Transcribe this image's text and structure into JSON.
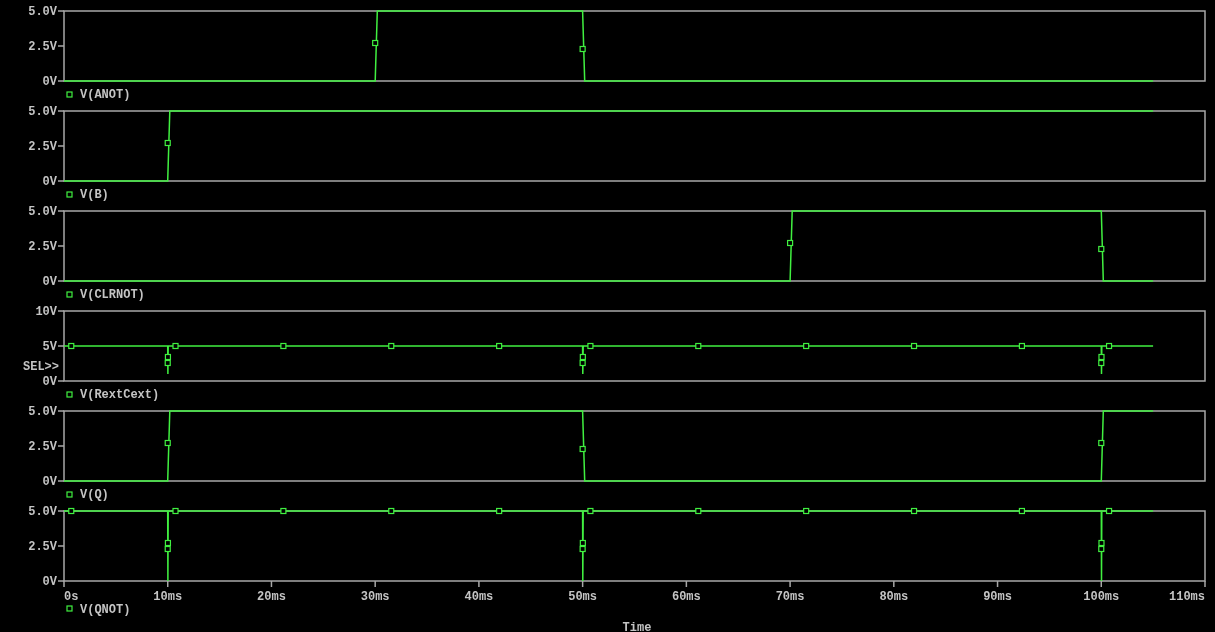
{
  "plots": [
    {
      "chart_data": {
        "type": "line",
        "xlim": [
          0,
          110
        ],
        "ylim": [
          0,
          5
        ],
        "yticks": [
          {
            "value": 0,
            "label": "0V"
          },
          {
            "value": 2.5,
            "label": "2.5V"
          },
          {
            "value": 5,
            "label": "5.0V"
          }
        ],
        "series": [
          {
            "name": "V(ANOT)",
            "color": "#40f040",
            "x": [
              0,
              30,
              30.2,
              50,
              50.2,
              105
            ],
            "values": [
              0,
              0,
              5,
              5,
              0,
              0
            ]
          }
        ]
      }
    },
    {
      "chart_data": {
        "type": "line",
        "xlim": [
          0,
          110
        ],
        "ylim": [
          0,
          5
        ],
        "yticks": [
          {
            "value": 0,
            "label": "0V"
          },
          {
            "value": 2.5,
            "label": "2.5V"
          },
          {
            "value": 5,
            "label": "5.0V"
          }
        ],
        "series": [
          {
            "name": "V(B)",
            "color": "#40f040",
            "x": [
              0,
              10,
              10.2,
              105
            ],
            "values": [
              0,
              0,
              5,
              5
            ]
          }
        ]
      }
    },
    {
      "chart_data": {
        "type": "line",
        "xlim": [
          0,
          110
        ],
        "ylim": [
          0,
          5
        ],
        "yticks": [
          {
            "value": 0,
            "label": "0V"
          },
          {
            "value": 2.5,
            "label": "2.5V"
          },
          {
            "value": 5,
            "label": "5.0V"
          }
        ],
        "series": [
          {
            "name": "V(CLRNOT)",
            "color": "#40f040",
            "x": [
              0,
              70,
              70.2,
              100,
              100.2,
              105
            ],
            "values": [
              0,
              0,
              5,
              5,
              0,
              0
            ]
          }
        ]
      }
    },
    {
      "selector_label": "SEL>>",
      "chart_data": {
        "type": "line",
        "xlim": [
          0,
          110
        ],
        "ylim": [
          0,
          10
        ],
        "yticks": [
          {
            "value": 0,
            "label": "0V"
          },
          {
            "value": 5,
            "label": "5V"
          },
          {
            "value": 10,
            "label": "10V"
          }
        ],
        "series": [
          {
            "name": "V(RextCext)",
            "color": "#40f040",
            "x": [
              0,
              10,
              10.02,
              10.05,
              50,
              50.02,
              50.05,
              100,
              100.02,
              100.05,
              105
            ],
            "values": [
              5,
              5,
              1,
              5,
              5,
              1,
              5,
              5,
              1,
              5,
              5
            ]
          }
        ]
      }
    },
    {
      "chart_data": {
        "type": "line",
        "xlim": [
          0,
          110
        ],
        "ylim": [
          0,
          5
        ],
        "yticks": [
          {
            "value": 0,
            "label": "0V"
          },
          {
            "value": 2.5,
            "label": "2.5V"
          },
          {
            "value": 5,
            "label": "5.0V"
          }
        ],
        "series": [
          {
            "name": "V(Q)",
            "color": "#40f040",
            "x": [
              0,
              10,
              10.2,
              50,
              50.2,
              100,
              100.2,
              105
            ],
            "values": [
              0,
              0,
              5,
              5,
              0,
              0,
              5,
              5
            ]
          }
        ]
      }
    },
    {
      "chart_data": {
        "type": "line",
        "xlabel": "Time",
        "xlim": [
          0,
          110
        ],
        "ylim": [
          0,
          5
        ],
        "yticks": [
          {
            "value": 0,
            "label": "0V"
          },
          {
            "value": 2.5,
            "label": "2.5V"
          },
          {
            "value": 5,
            "label": "5.0V"
          }
        ],
        "xticks": [
          {
            "value": 0,
            "label": "0s"
          },
          {
            "value": 10,
            "label": "10ms"
          },
          {
            "value": 20,
            "label": "20ms"
          },
          {
            "value": 30,
            "label": "30ms"
          },
          {
            "value": 40,
            "label": "40ms"
          },
          {
            "value": 50,
            "label": "50ms"
          },
          {
            "value": 60,
            "label": "60ms"
          },
          {
            "value": 70,
            "label": "70ms"
          },
          {
            "value": 80,
            "label": "80ms"
          },
          {
            "value": 90,
            "label": "90ms"
          },
          {
            "value": 100,
            "label": "100ms"
          },
          {
            "value": 110,
            "label": "110ms"
          }
        ],
        "series": [
          {
            "name": "V(QNOT)",
            "color": "#40f040",
            "x": [
              0,
              10,
              10.02,
              10.05,
              50,
              50.02,
              50.05,
              100,
              100.02,
              100.05,
              105
            ],
            "values": [
              5,
              5,
              0,
              5,
              5,
              0,
              5,
              5,
              0,
              5,
              5
            ]
          }
        ]
      }
    }
  ]
}
